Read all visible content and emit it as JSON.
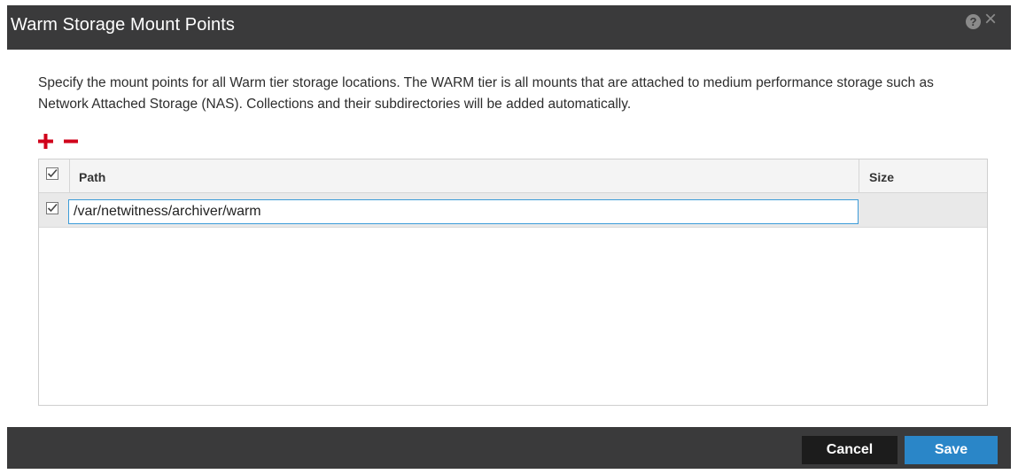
{
  "dialog": {
    "title": "Warm Storage Mount Points",
    "help_icon": "question-circle-icon",
    "close_icon": "close-x-icon",
    "help_glyph": "?",
    "close_glyph": "×"
  },
  "description": "Specify the mount points for all Warm tier storage locations. The WARM tier is all mounts that are attached to medium performance storage such as Network Attached Storage (NAS). Collections and their subdirectories will be added automatically.",
  "toolbar": {
    "add_icon": "plus-icon",
    "remove_icon": "minus-icon",
    "accent_color": "#d0021b"
  },
  "grid": {
    "columns": [
      {
        "label": "Path"
      },
      {
        "label": "Size"
      }
    ],
    "header_checked": true,
    "rows": [
      {
        "checked": true,
        "path": "/var/netwitness/archiver/warm",
        "size": ""
      }
    ]
  },
  "footer": {
    "cancel_label": "Cancel",
    "save_label": "Save",
    "save_color": "#2a86c8"
  }
}
